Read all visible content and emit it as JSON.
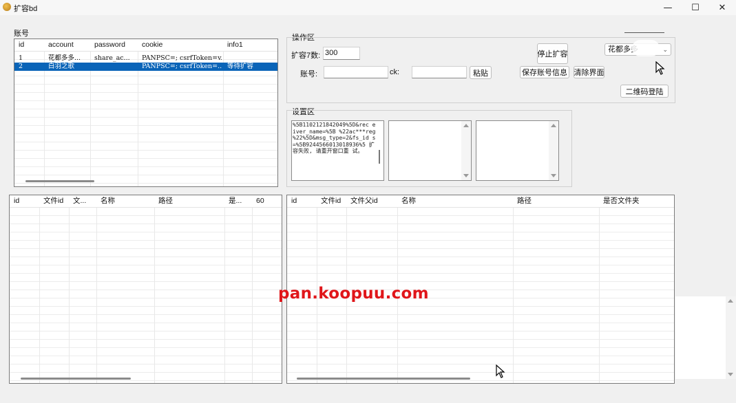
{
  "window": {
    "title": "扩容bd",
    "minimize_glyph": "—",
    "maximize_glyph": "☐",
    "close_glyph": "✕"
  },
  "accounts": {
    "group_label": "账号",
    "columns": [
      "id",
      "account",
      "password",
      "cookie",
      "info1"
    ],
    "rows": [
      [
        "1",
        "花都多多...",
        "share_ac...",
        "PANPSC=; csrfToken=v...",
        ""
      ],
      [
        "2",
        "白羽之歌",
        "",
        "PANPSC=; csrfToken=...",
        "等待扩容"
      ]
    ],
    "selected_row": 1
  },
  "operation": {
    "group_label": "操作区",
    "expand_count_label": "扩容7数:",
    "expand_count_value": "300",
    "account_label": "账号:",
    "account_value": "",
    "ck_label": "ck:",
    "ck_value": "",
    "paste_button": "粘贴",
    "stop_button": "停止扩容",
    "save_button": "保存账号信息",
    "clear_button": "清除界面",
    "qr_login_button": "二维码登陆",
    "account_select_value": "花都多多"
  },
  "settings": {
    "group_label": "设置区",
    "log_text": "%5B1102121842049%5D&rec eiver_name=%5B %22ac***reg %22%5D&msg_type=2&fs_id s=%5B9244566013018936%5 扩容失败, 请重开窗口重 试。",
    "box2_text": "",
    "box3_text": ""
  },
  "file_list_left": {
    "columns": [
      "id",
      "文件id",
      "文...",
      "名称",
      "路径",
      "是...",
      "60"
    ]
  },
  "file_list_right": {
    "columns": [
      "id",
      "文件id",
      "文件父id",
      "名称",
      "路径",
      "是否文件夹"
    ]
  },
  "watermark": "pan.koopuu.com"
}
